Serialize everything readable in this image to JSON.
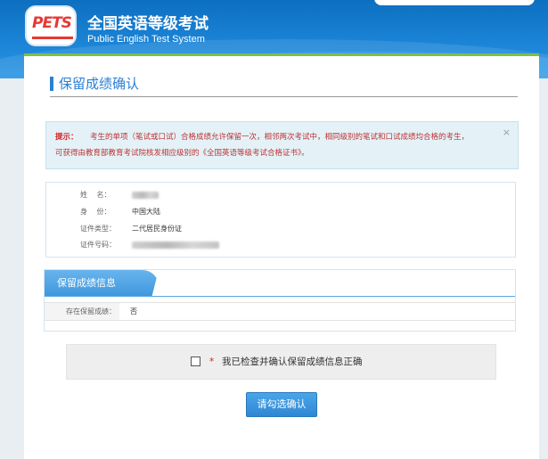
{
  "header": {
    "logo_text": "PETS",
    "title": "全国英语等级考试",
    "subtitle": "Public English Test System"
  },
  "page": {
    "title": "保留成绩确认"
  },
  "alert": {
    "label": "提示：",
    "line1": "考生的单项（笔试或口试）合格成绩允许保留一次，相邻两次考试中，相同级别的笔试和口试成绩均合格的考生，",
    "line2": "可获得由教育部教育考试院核发相应级别的《全国英语等级考试合格证书》。",
    "close": "×"
  },
  "info": {
    "name_label": "姓　 名：",
    "identity_label": "身　 份：",
    "identity_value": "中国大陆",
    "id_type_label": "证件类型：",
    "id_type_value": "二代居民身份证",
    "id_number_label": "证件号码："
  },
  "score": {
    "tab_label": "保留成绩信息",
    "row_label": "存在保留成绩：",
    "row_value": "否"
  },
  "confirm": {
    "star": "*",
    "text": "我已检查并确认保留成绩信息正确",
    "checked": false
  },
  "button": {
    "label": "请勾选确认"
  },
  "colors": {
    "header_blue": "#1b84d6",
    "accent_green": "#7cc04a",
    "title_blue": "#2a7fd4",
    "alert_red": "#d42020"
  }
}
